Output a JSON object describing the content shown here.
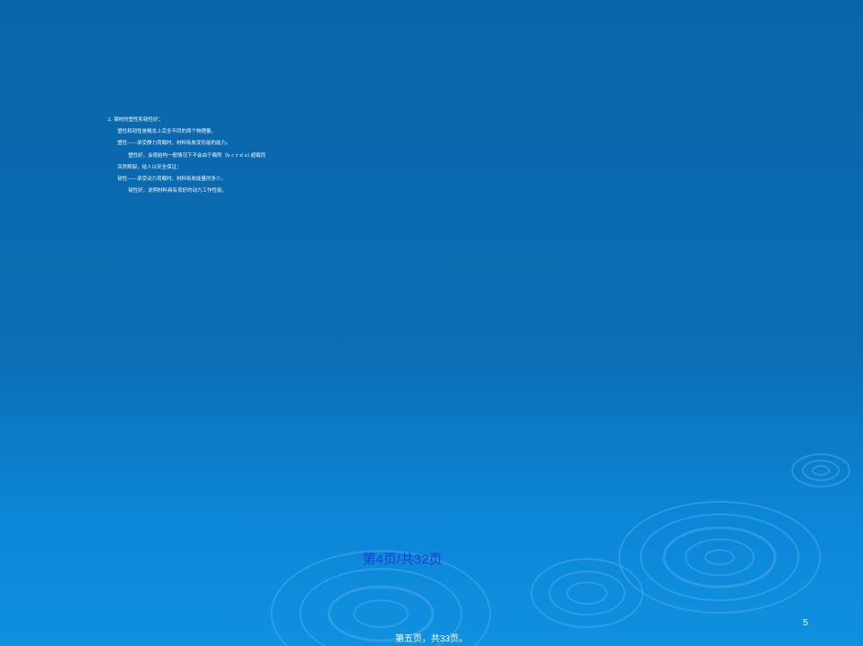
{
  "slide": {
    "lines": [
      "2. 钢材的塑性和韧性好；",
      "塑性和韧性是概念上完全不同的两个物理量。",
      "塑性——承受静力荷载时，材料吸收变形能的能力。",
      "塑性好，会使结构一般情况下不会由于偶然（b c r d e) 超载而",
      "突然断裂，给人以安全保证；",
      "韧性——承受动力荷载时，材料吸收能量的多少。",
      "韧性好，说明材料具有良好的动力工作性能。"
    ],
    "page_indicator": "第4页/共32页",
    "slide_number": "5",
    "footer": "第五页，共33页。"
  },
  "colors": {
    "background_top": "#0a64a8",
    "background_bottom": "#1190e0",
    "page_indicator": "#1a3fd6",
    "text": "#ffffff"
  }
}
